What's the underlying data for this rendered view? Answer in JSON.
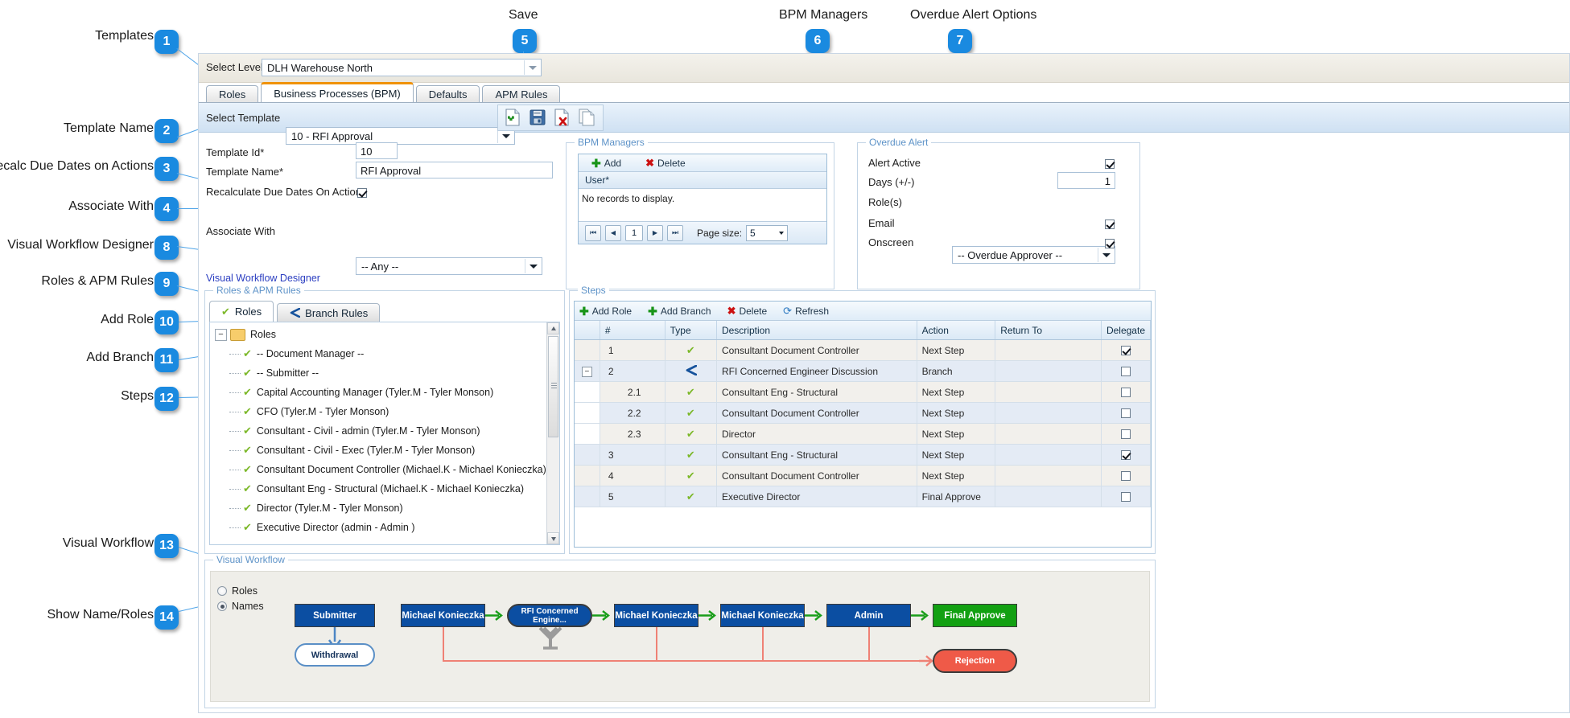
{
  "annotations": [
    {
      "n": "1",
      "label": "Templates"
    },
    {
      "n": "2",
      "label": "Template Name"
    },
    {
      "n": "3",
      "label": "Recalc Due Dates on Actions"
    },
    {
      "n": "4",
      "label": "Associate With"
    },
    {
      "n": "5",
      "label": "Save"
    },
    {
      "n": "6",
      "label": "BPM Managers"
    },
    {
      "n": "7",
      "label": "Overdue Alert Options"
    },
    {
      "n": "8",
      "label": "Visual Workflow Designer"
    },
    {
      "n": "9",
      "label": "Roles & APM Rules"
    },
    {
      "n": "10",
      "label": "Add Role"
    },
    {
      "n": "11",
      "label": "Add Branch"
    },
    {
      "n": "12",
      "label": "Steps"
    },
    {
      "n": "13",
      "label": "Visual Workflow"
    },
    {
      "n": "14",
      "label": "Show Name/Roles"
    }
  ],
  "header": {
    "select_level_label": "Select Level",
    "select_level_value": "DLH Warehouse North"
  },
  "tabs": [
    {
      "label": "Roles",
      "active": false
    },
    {
      "label": "Business Processes (BPM)",
      "active": true
    },
    {
      "label": "Defaults",
      "active": false
    },
    {
      "label": "APM Rules",
      "active": false
    }
  ],
  "template_bar": {
    "select_template_label": "Select Template",
    "select_template_value": "10 - RFI Approval"
  },
  "toolbar": {
    "new_icon": "new-document-icon",
    "save_icon": "save-disk-icon",
    "delete_icon": "delete-document-icon",
    "copy_icon": "copy-document-icon"
  },
  "form": {
    "template_id_label": "Template Id*",
    "template_id_value": "10",
    "template_name_label": "Template Name*",
    "template_name_value": "RFI Approval",
    "recalc_label": "Recalculate Due Dates On Actions",
    "recalc_checked": true,
    "associate_label": "Associate With",
    "associate_value": "-- Any --"
  },
  "bpm_managers": {
    "title": "BPM Managers",
    "add_label": "Add",
    "delete_label": "Delete",
    "column_user": "User*",
    "empty_text": "No records to display.",
    "page_number": "1",
    "page_size_label": "Page size:",
    "page_size_value": "5",
    "first_icon": "first-page-icon",
    "prev_icon": "previous-page-icon",
    "next_icon": "next-page-icon",
    "last_icon": "last-page-icon"
  },
  "overdue_alert": {
    "title": "Overdue Alert",
    "alert_active_label": "Alert Active",
    "alert_active_checked": true,
    "days_label": "Days (+/-)",
    "days_value": "1",
    "roles_label": "Role(s)",
    "roles_value": "-- Overdue Approver --",
    "email_label": "Email",
    "email_checked": true,
    "onscreen_label": "Onscreen",
    "onscreen_checked": true
  },
  "designer_link": "Visual Workflow Designer",
  "roles_panel": {
    "title": "Roles & APM Rules",
    "tab_roles": "Roles",
    "tab_branch_rules": "Branch Rules",
    "root_label": "Roles",
    "root_icon": "folder-icon",
    "items": [
      "-- Document Manager --",
      "-- Submitter --",
      "Capital Accounting Manager (Tyler.M - Tyler Monson)",
      "CFO (Tyler.M - Tyler Monson)",
      "Consultant - Civil - admin (Tyler.M - Tyler Monson)",
      "Consultant - Civil - Exec (Tyler.M - Tyler Monson)",
      "Consultant Document Controller (Michael.K - Michael Konieczka)",
      "Consultant Eng - Structural (Michael.K - Michael Konieczka)",
      "Director (Tyler.M - Tyler Monson)",
      "Executive Director (admin - Admin )"
    ]
  },
  "steps_panel": {
    "title": "Steps",
    "add_role_label": "Add Role",
    "add_branch_label": "Add Branch",
    "delete_label": "Delete",
    "refresh_label": "Refresh",
    "columns": [
      "#",
      "",
      "Type",
      "Description",
      "Action",
      "Return To",
      "Delegate"
    ],
    "rows": [
      {
        "num": "1",
        "sub": "",
        "type": "check",
        "desc": "Consultant Document Controller",
        "action": "Next Step",
        "return_to": "",
        "delegate": true,
        "expander": false,
        "indent": 0
      },
      {
        "num": "2",
        "sub": "",
        "type": "branch",
        "desc": "RFI Concerned Engineer Discussion",
        "action": "Branch",
        "return_to": "",
        "delegate": false,
        "expander": true,
        "indent": 0
      },
      {
        "num": "2.1",
        "sub": "",
        "type": "check",
        "desc": "Consultant Eng - Structural",
        "action": "Next Step",
        "return_to": "",
        "delegate": false,
        "expander": false,
        "indent": 1
      },
      {
        "num": "2.2",
        "sub": "",
        "type": "check",
        "desc": "Consultant Document Controller",
        "action": "Next Step",
        "return_to": "",
        "delegate": false,
        "expander": false,
        "indent": 1
      },
      {
        "num": "2.3",
        "sub": "",
        "type": "check",
        "desc": "Director",
        "action": "Next Step",
        "return_to": "",
        "delegate": false,
        "expander": false,
        "indent": 1
      },
      {
        "num": "3",
        "sub": "",
        "type": "check",
        "desc": "Consultant Eng - Structural",
        "action": "Next Step",
        "return_to": "",
        "delegate": true,
        "expander": false,
        "indent": 0
      },
      {
        "num": "4",
        "sub": "",
        "type": "check",
        "desc": "Consultant Document Controller",
        "action": "Next Step",
        "return_to": "",
        "delegate": false,
        "expander": false,
        "indent": 0
      },
      {
        "num": "5",
        "sub": "",
        "type": "check",
        "desc": "Executive Director",
        "action": "Final Approve",
        "return_to": "",
        "delegate": false,
        "expander": false,
        "indent": 0
      }
    ]
  },
  "visual_workflow": {
    "title": "Visual Workflow",
    "radio_roles_label": "Roles",
    "radio_names_label": "Names",
    "selected_radio": "Names",
    "nodes": {
      "submitter": "Submitter",
      "withdrawal": "Withdrawal",
      "step1": "Michael Konieczka",
      "branch": "RFI Concerned Engine...",
      "step3": "Michael Konieczka",
      "step4": "Michael Konieczka",
      "step5": "Admin",
      "final": "Final Approve",
      "rejection": "Rejection"
    }
  },
  "colors": {
    "accent_blue": "#1a8ae0",
    "node_blue": "#0b4ea2",
    "node_green": "#12a012",
    "reject_red": "#ef5a48",
    "tab_orange": "#f0920a"
  }
}
